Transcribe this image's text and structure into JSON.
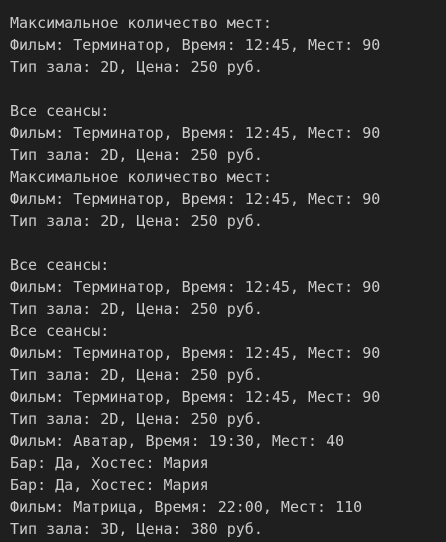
{
  "terminal": {
    "lines": [
      "Максимальное количество мест:",
      "Фильм: Терминатор, Время: 12:45, Мест: 90",
      "Тип зала: 2D, Цена: 250 руб.",
      "",
      "Все сеансы:",
      "Фильм: Терминатор, Время: 12:45, Мест: 90",
      "Тип зала: 2D, Цена: 250 руб.",
      "Максимальное количество мест:",
      "Фильм: Терминатор, Время: 12:45, Мест: 90",
      "Тип зала: 2D, Цена: 250 руб.",
      "",
      "Все сеансы:",
      "Фильм: Терминатор, Время: 12:45, Мест: 90",
      "Тип зала: 2D, Цена: 250 руб.",
      "Все сеансы:",
      "Фильм: Терминатор, Время: 12:45, Мест: 90",
      "Тип зала: 2D, Цена: 250 руб.",
      "Фильм: Терминатор, Время: 12:45, Мест: 90",
      "Тип зала: 2D, Цена: 250 руб.",
      "Фильм: Аватар, Время: 19:30, Мест: 40",
      "Бар: Да, Хостес: Мария",
      "Бар: Да, Хостес: Мария",
      "Фильм: Матрица, Время: 22:00, Мест: 110",
      "Тип зала: 3D, Цена: 380 руб."
    ]
  }
}
